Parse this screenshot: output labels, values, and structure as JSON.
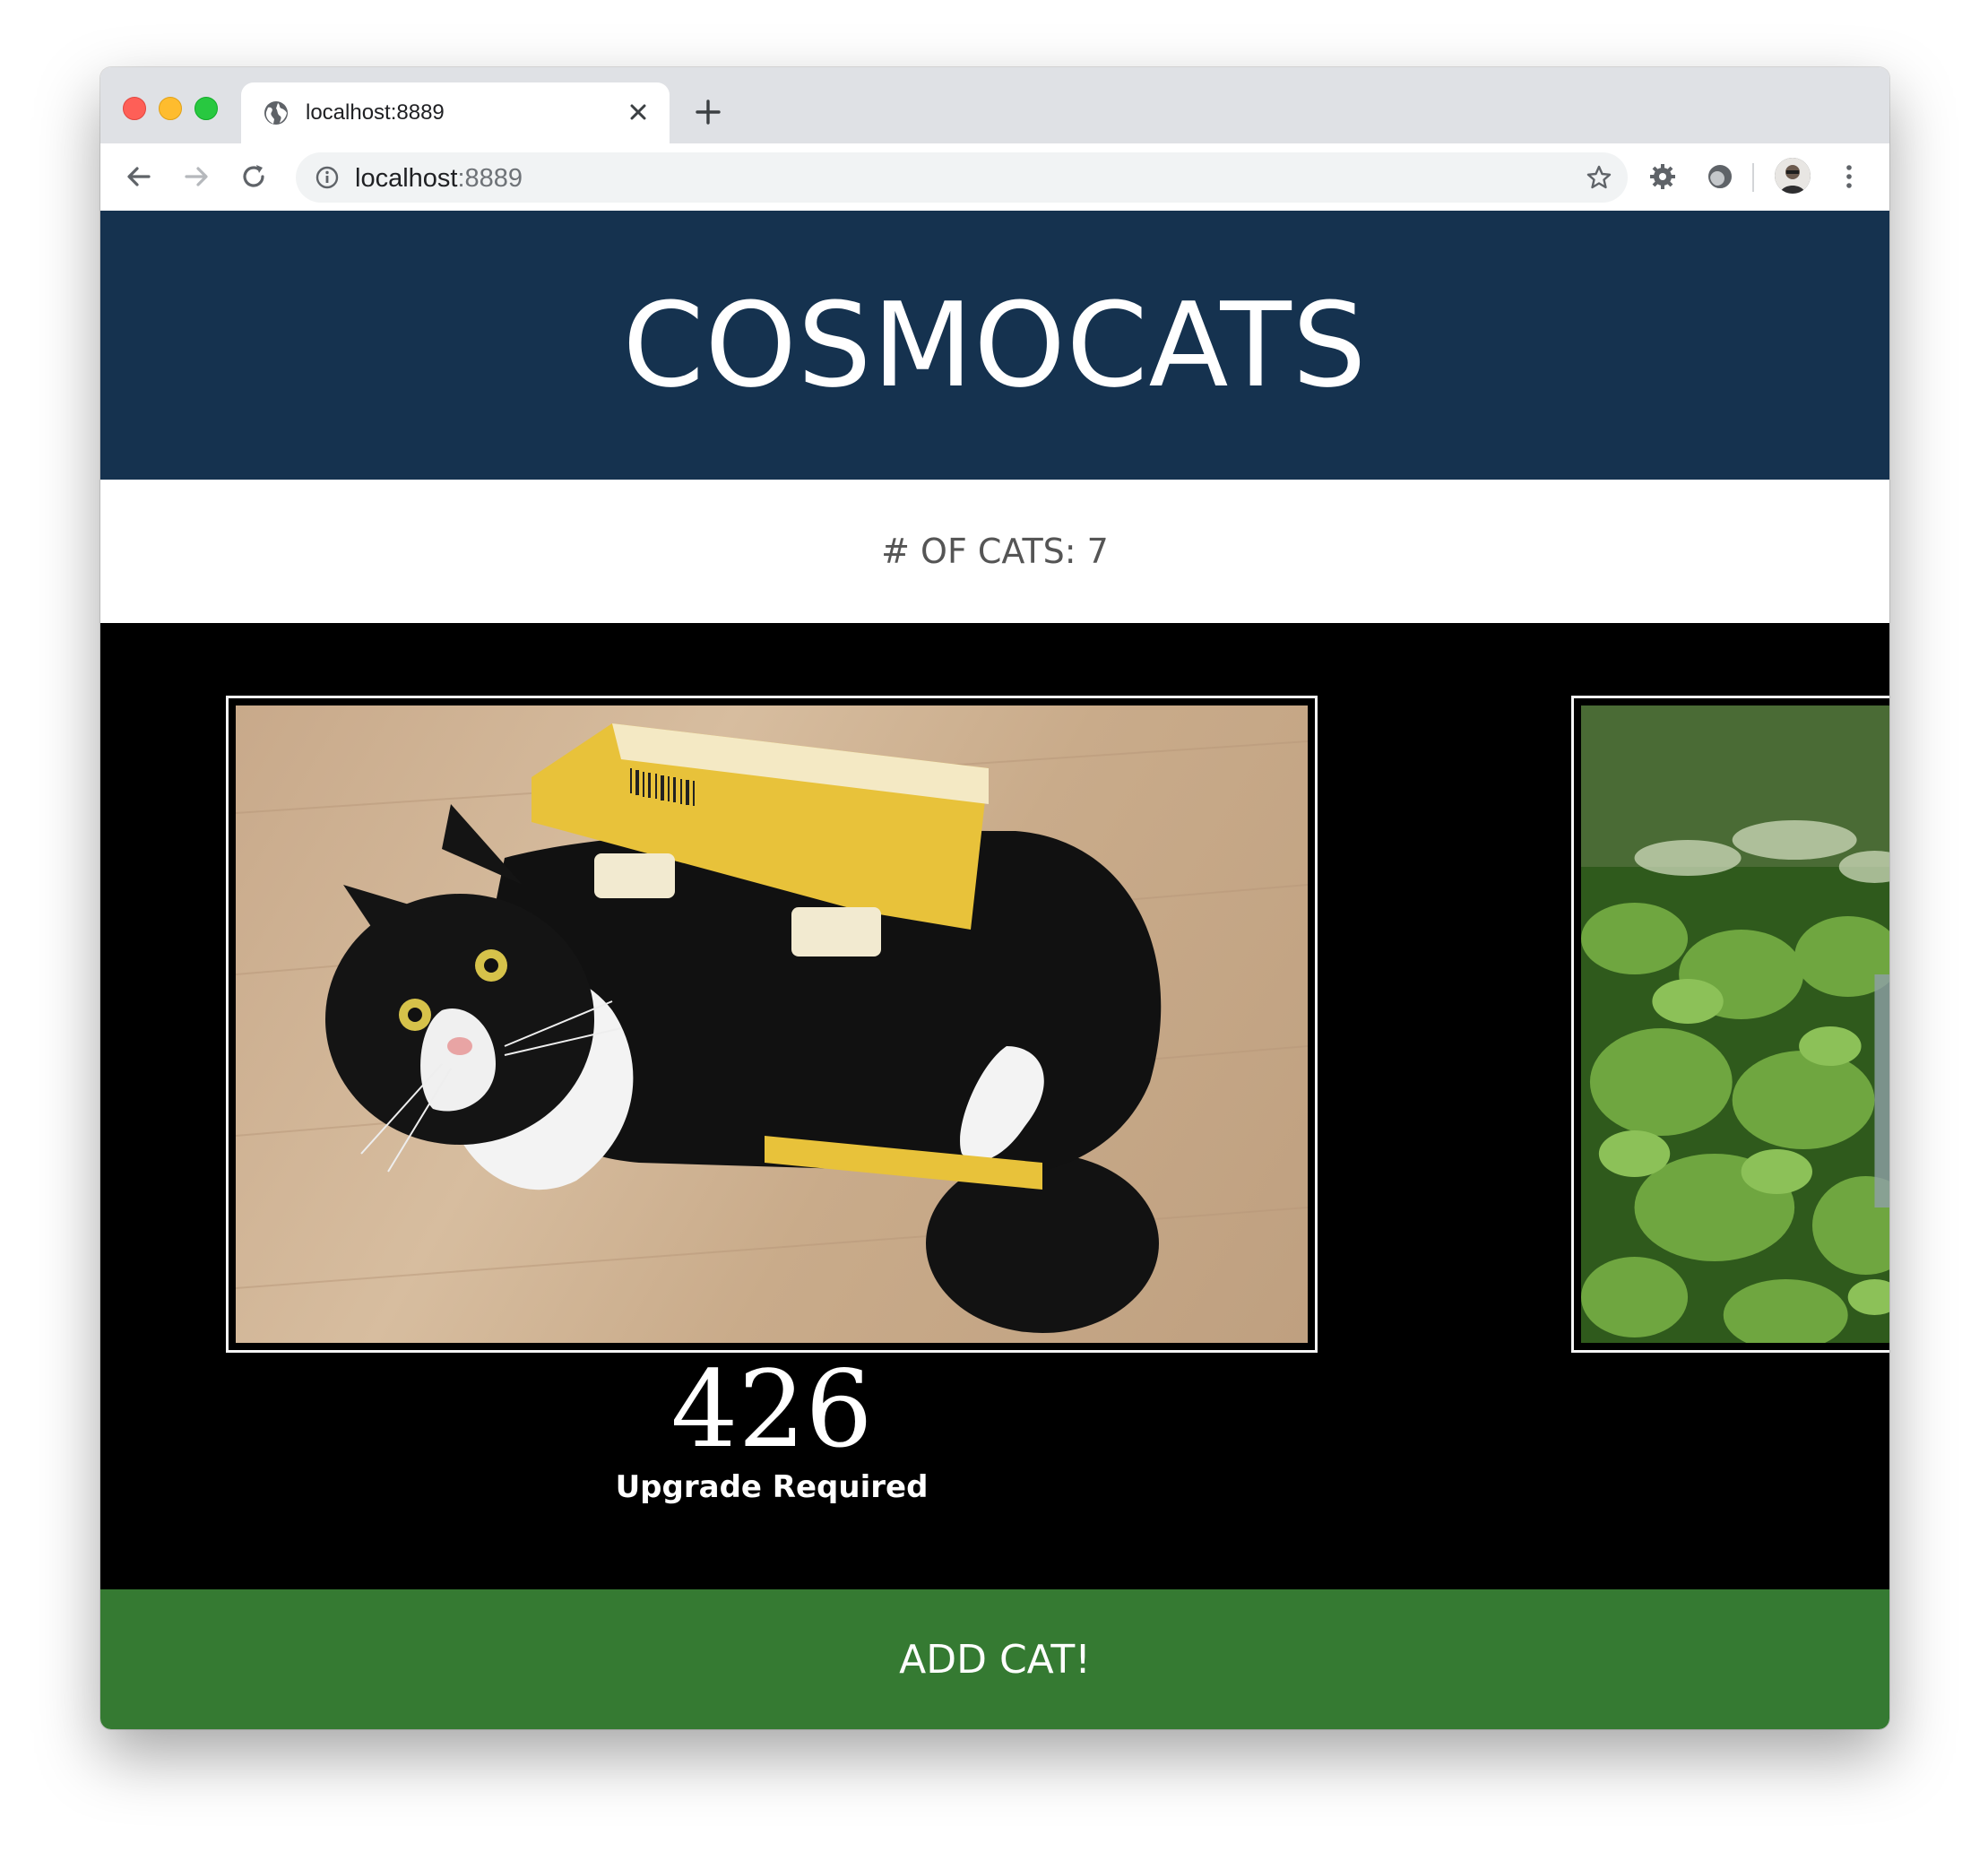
{
  "browser": {
    "tab_title": "localhost:8889",
    "url_host": "localhost",
    "url_port": ":8889",
    "icons": [
      "globe-icon",
      "close-icon",
      "plus-icon",
      "back-arrow-icon",
      "forward-arrow-icon",
      "reload-icon",
      "info-icon",
      "star-icon",
      "extension-gear-icon",
      "extension-circle-icon",
      "profile-avatar",
      "more-vert-icon"
    ]
  },
  "header": {
    "title": "COSMOCATS",
    "background": "#15324f"
  },
  "count": {
    "label": "# OF CATS: 7"
  },
  "gallery": {
    "cards": [
      {
        "subject": "tuxedo cat lying under a yellow cardboard box",
        "caption_number": "426",
        "caption_text": "Upgrade Required"
      },
      {
        "subject": "green foliage (partially visible)"
      }
    ]
  },
  "actions": {
    "add_label": "ADD CAT!",
    "add_color": "#357a32"
  }
}
